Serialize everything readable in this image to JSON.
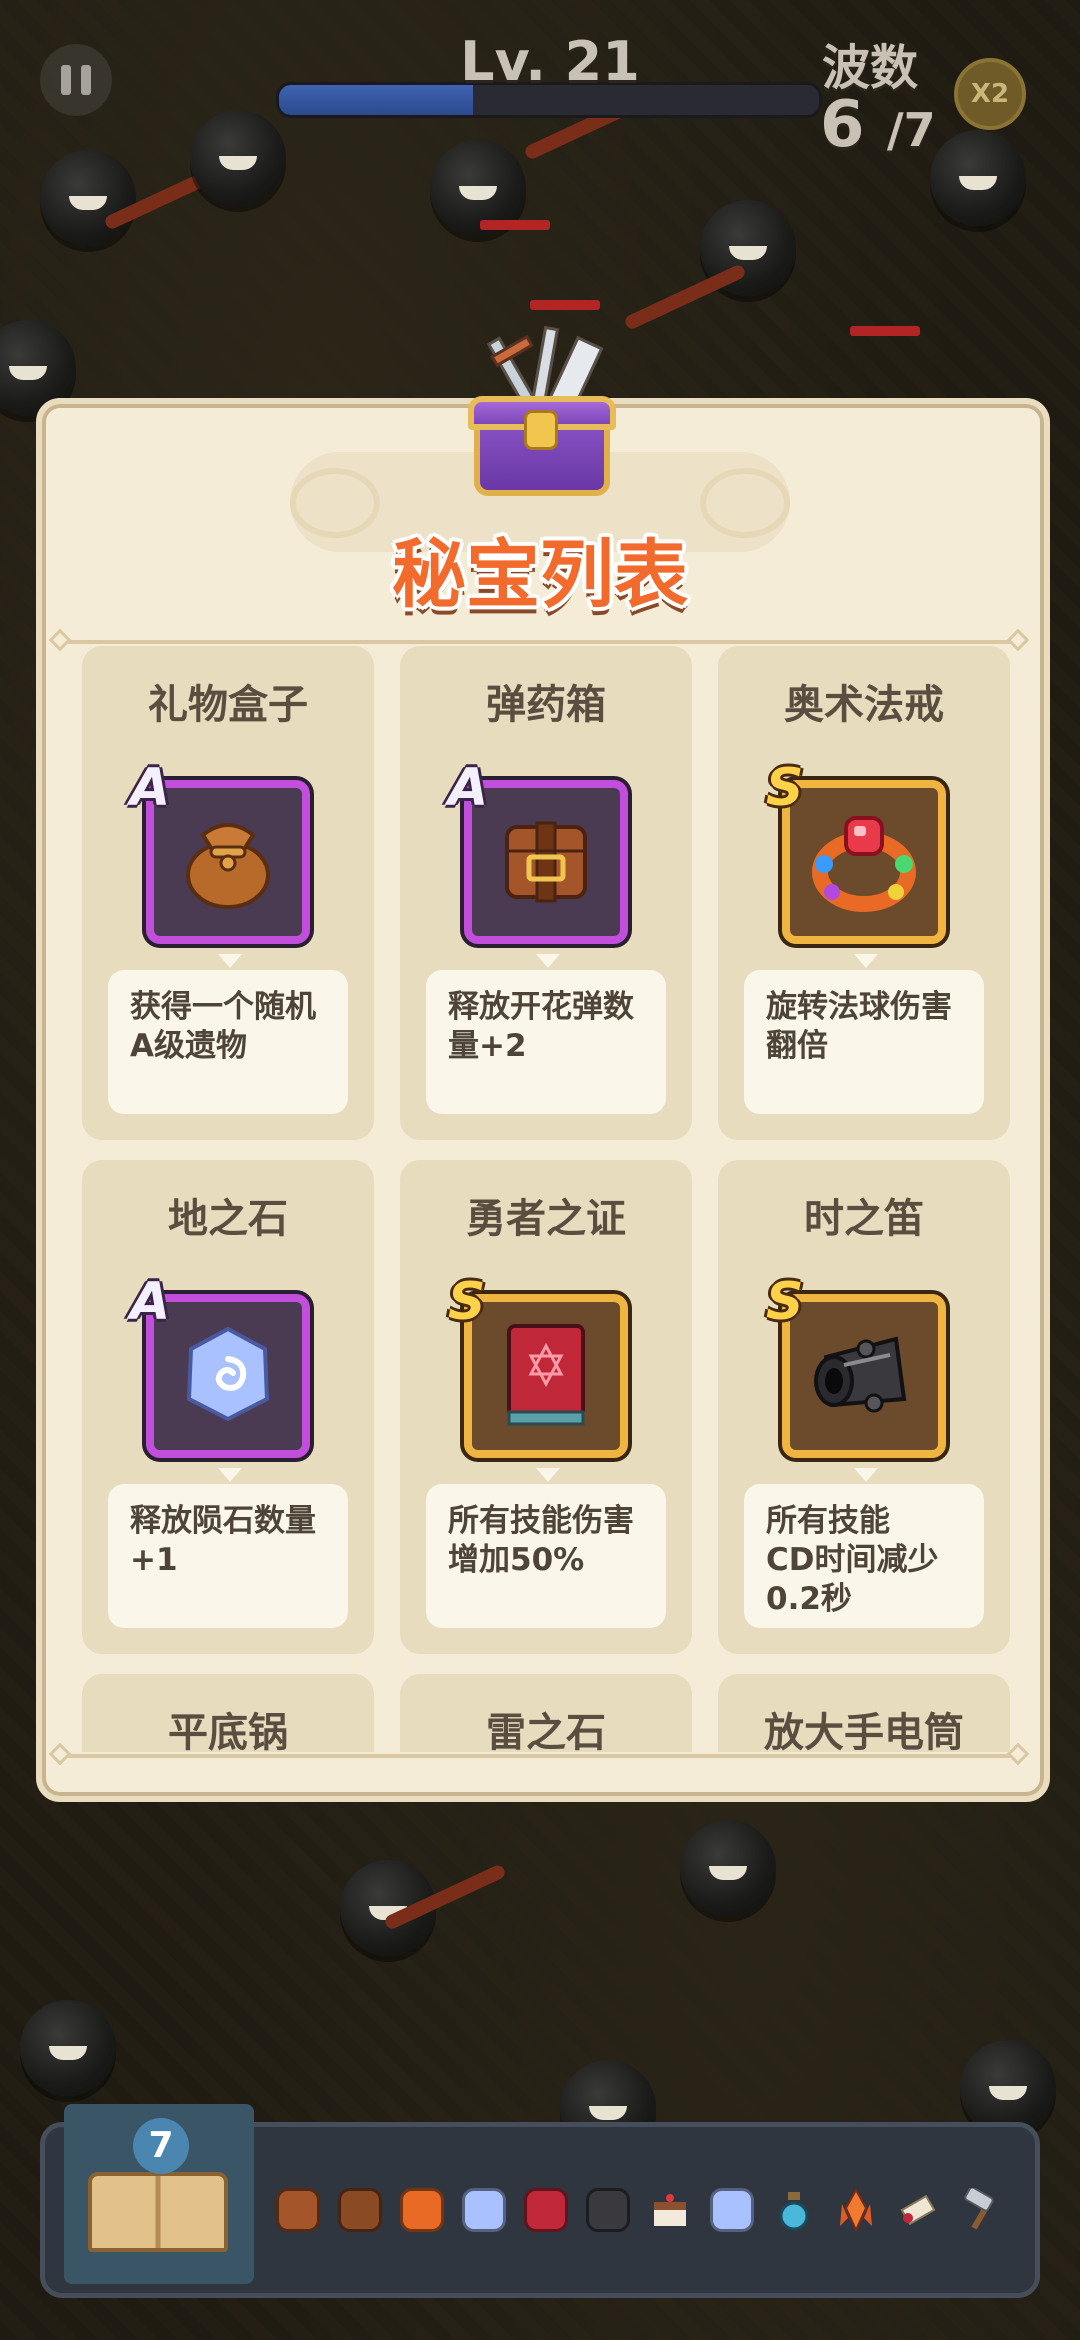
{
  "hud": {
    "level": "Lv. 21",
    "xp_progress": 0.36,
    "wave_label": "波数",
    "wave_current": "6",
    "wave_total": "/7",
    "speed_label": "X2"
  },
  "panel": {
    "title": "秘宝列表"
  },
  "relics": [
    {
      "name": "礼物盒子",
      "rank": "A",
      "icon": "pouch-icon",
      "desc": "获得一个随机\nA级遗物"
    },
    {
      "name": "弹药箱",
      "rank": "A",
      "icon": "ammo-box-icon",
      "desc": "释放开花弹数\n量+2"
    },
    {
      "name": "奥术法戒",
      "rank": "S",
      "icon": "ring-icon",
      "desc": "旋转法球伤害\n翻倍"
    },
    {
      "name": "地之石",
      "rank": "A",
      "icon": "earth-stone-icon",
      "desc": "释放陨石数量\n+1"
    },
    {
      "name": "勇者之证",
      "rank": "S",
      "icon": "book-icon",
      "desc": "所有技能伤害\n增加50%"
    },
    {
      "name": "时之笛",
      "rank": "S",
      "icon": "cannon-icon",
      "desc": "所有技能\nCD时间减少\n0.2秒"
    },
    {
      "name": "平底锅",
      "rank": "",
      "icon": "",
      "desc": ""
    },
    {
      "name": "雷之石",
      "rank": "",
      "icon": "",
      "desc": ""
    },
    {
      "name": "放大手电筒",
      "rank": "",
      "icon": "",
      "desc": ""
    }
  ],
  "relic_bar": {
    "book_count": "7",
    "items": [
      "pouch-icon",
      "ammo-box-icon",
      "ring-icon",
      "earth-stone-icon",
      "book-icon",
      "cannon-icon",
      "cake-icon",
      "earth-stone-icon",
      "potion-icon",
      "crystal-icon",
      "scroll-icon",
      "hammer-icon"
    ]
  },
  "colors": {
    "rank_A_frame": "#c14fdc",
    "rank_S_frame": "#f0b440",
    "title": "#f26a2c",
    "panel_bg": "#f5ecd8",
    "card_bg": "#e8dcbf"
  }
}
